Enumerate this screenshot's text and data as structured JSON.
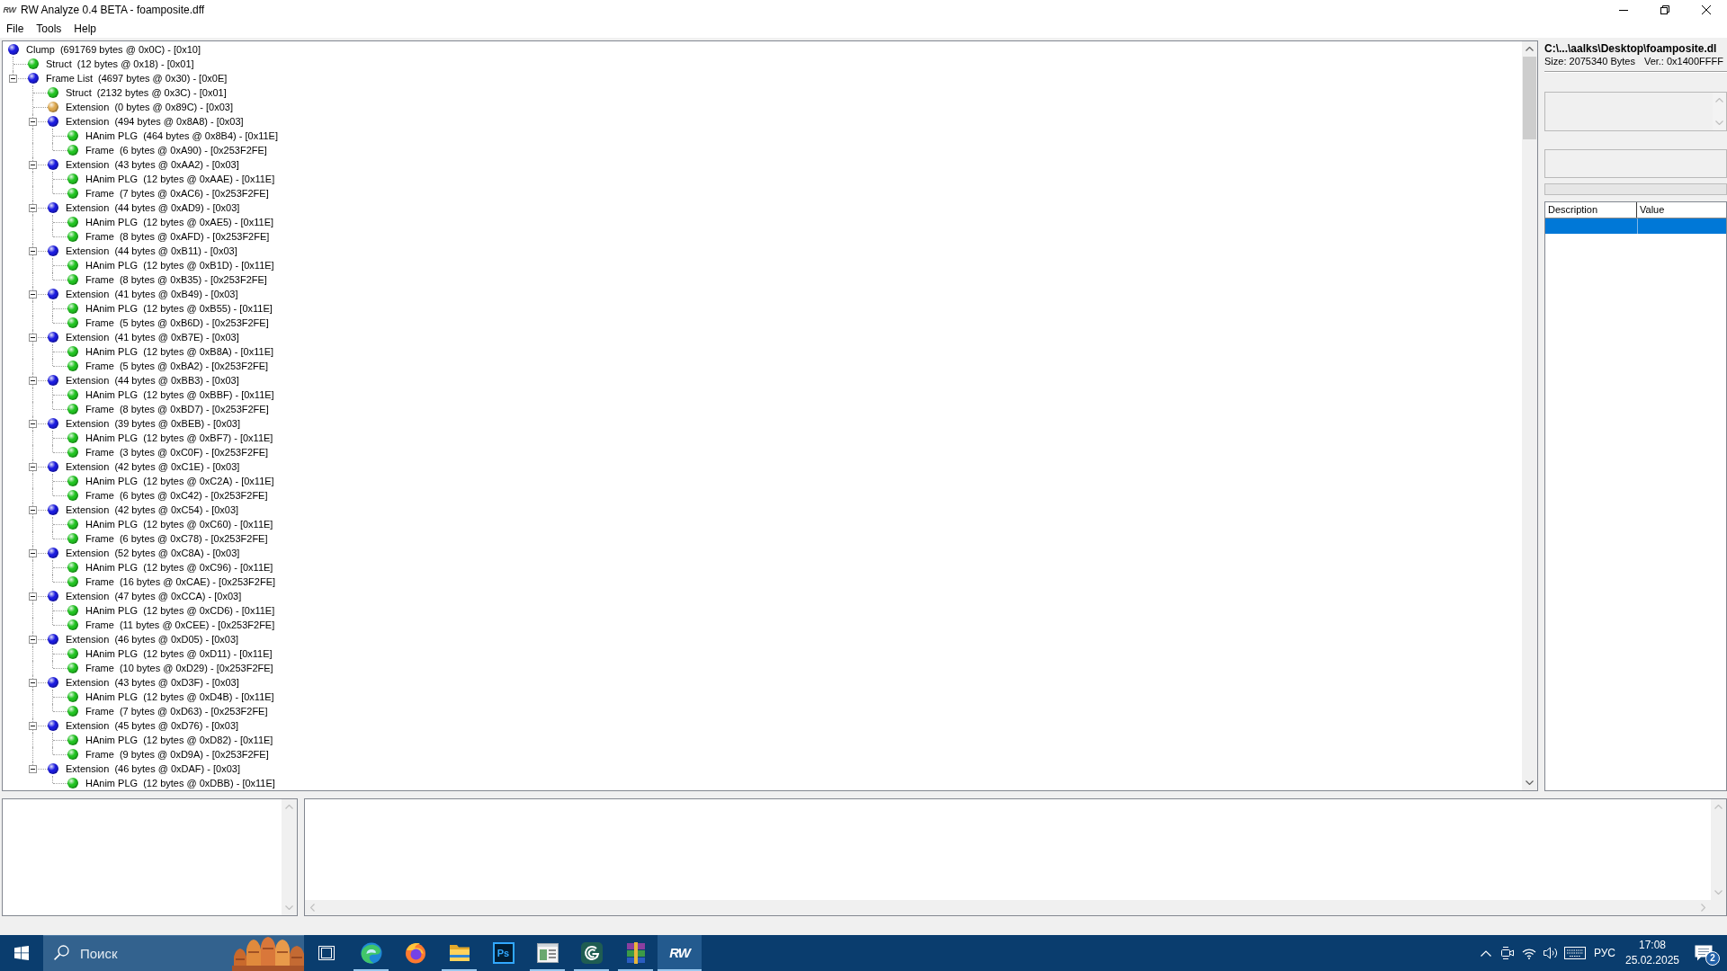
{
  "window": {
    "icon_text": "RW",
    "title": "RW Analyze 0.4 BETA - foamposite.dff"
  },
  "menu": [
    "File",
    "Tools",
    "Help"
  ],
  "tree": [
    {
      "label": "Clump  (691769 bytes @ 0x0C) - [0x10]",
      "color": "#1c1ce0",
      "children": [
        {
          "label": "Struct  (12 bytes @ 0x18) - [0x01]",
          "color": "#22c422"
        },
        {
          "label": "Frame List  (4697 bytes @ 0x30) - [0x0E]",
          "color": "#1c1ce0",
          "expanded": true,
          "children": [
            {
              "label": "Struct  (2132 bytes @ 0x3C) - [0x01]",
              "color": "#22c422"
            },
            {
              "label": "Extension  (0 bytes @ 0x89C) - [0x03]",
              "color": "#dea94f"
            },
            {
              "label": "Extension  (494 bytes @ 0x8A8) - [0x03]",
              "color": "#1c1ce0",
              "expanded": true,
              "children": [
                {
                  "label": "HAnim PLG  (464 bytes @ 0x8B4) - [0x11E]",
                  "color": "#22c422"
                },
                {
                  "label": "Frame  (6 bytes @ 0xA90) - [0x253F2FE]",
                  "color": "#22c422"
                }
              ]
            },
            {
              "label": "Extension  (43 bytes @ 0xAA2) - [0x03]",
              "color": "#1c1ce0",
              "expanded": true,
              "children": [
                {
                  "label": "HAnim PLG  (12 bytes @ 0xAAE) - [0x11E]",
                  "color": "#22c422"
                },
                {
                  "label": "Frame  (7 bytes @ 0xAC6) - [0x253F2FE]",
                  "color": "#22c422"
                }
              ]
            },
            {
              "label": "Extension  (44 bytes @ 0xAD9) - [0x03]",
              "color": "#1c1ce0",
              "expanded": true,
              "children": [
                {
                  "label": "HAnim PLG  (12 bytes @ 0xAE5) - [0x11E]",
                  "color": "#22c422"
                },
                {
                  "label": "Frame  (8 bytes @ 0xAFD) - [0x253F2FE]",
                  "color": "#22c422"
                }
              ]
            },
            {
              "label": "Extension  (44 bytes @ 0xB11) - [0x03]",
              "color": "#1c1ce0",
              "expanded": true,
              "children": [
                {
                  "label": "HAnim PLG  (12 bytes @ 0xB1D) - [0x11E]",
                  "color": "#22c422"
                },
                {
                  "label": "Frame  (8 bytes @ 0xB35) - [0x253F2FE]",
                  "color": "#22c422"
                }
              ]
            },
            {
              "label": "Extension  (41 bytes @ 0xB49) - [0x03]",
              "color": "#1c1ce0",
              "expanded": true,
              "children": [
                {
                  "label": "HAnim PLG  (12 bytes @ 0xB55) - [0x11E]",
                  "color": "#22c422"
                },
                {
                  "label": "Frame  (5 bytes @ 0xB6D) - [0x253F2FE]",
                  "color": "#22c422"
                }
              ]
            },
            {
              "label": "Extension  (41 bytes @ 0xB7E) - [0x03]",
              "color": "#1c1ce0",
              "expanded": true,
              "children": [
                {
                  "label": "HAnim PLG  (12 bytes @ 0xB8A) - [0x11E]",
                  "color": "#22c422"
                },
                {
                  "label": "Frame  (5 bytes @ 0xBA2) - [0x253F2FE]",
                  "color": "#22c422"
                }
              ]
            },
            {
              "label": "Extension  (44 bytes @ 0xBB3) - [0x03]",
              "color": "#1c1ce0",
              "expanded": true,
              "children": [
                {
                  "label": "HAnim PLG  (12 bytes @ 0xBBF) - [0x11E]",
                  "color": "#22c422"
                },
                {
                  "label": "Frame  (8 bytes @ 0xBD7) - [0x253F2FE]",
                  "color": "#22c422"
                }
              ]
            },
            {
              "label": "Extension  (39 bytes @ 0xBEB) - [0x03]",
              "color": "#1c1ce0",
              "expanded": true,
              "children": [
                {
                  "label": "HAnim PLG  (12 bytes @ 0xBF7) - [0x11E]",
                  "color": "#22c422"
                },
                {
                  "label": "Frame  (3 bytes @ 0xC0F) - [0x253F2FE]",
                  "color": "#22c422"
                }
              ]
            },
            {
              "label": "Extension  (42 bytes @ 0xC1E) - [0x03]",
              "color": "#1c1ce0",
              "expanded": true,
              "children": [
                {
                  "label": "HAnim PLG  (12 bytes @ 0xC2A) - [0x11E]",
                  "color": "#22c422"
                },
                {
                  "label": "Frame  (6 bytes @ 0xC42) - [0x253F2FE]",
                  "color": "#22c422"
                }
              ]
            },
            {
              "label": "Extension  (42 bytes @ 0xC54) - [0x03]",
              "color": "#1c1ce0",
              "expanded": true,
              "children": [
                {
                  "label": "HAnim PLG  (12 bytes @ 0xC60) - [0x11E]",
                  "color": "#22c422"
                },
                {
                  "label": "Frame  (6 bytes @ 0xC78) - [0x253F2FE]",
                  "color": "#22c422"
                }
              ]
            },
            {
              "label": "Extension  (52 bytes @ 0xC8A) - [0x03]",
              "color": "#1c1ce0",
              "expanded": true,
              "children": [
                {
                  "label": "HAnim PLG  (12 bytes @ 0xC96) - [0x11E]",
                  "color": "#22c422"
                },
                {
                  "label": "Frame  (16 bytes @ 0xCAE) - [0x253F2FE]",
                  "color": "#22c422"
                }
              ]
            },
            {
              "label": "Extension  (47 bytes @ 0xCCA) - [0x03]",
              "color": "#1c1ce0",
              "expanded": true,
              "children": [
                {
                  "label": "HAnim PLG  (12 bytes @ 0xCD6) - [0x11E]",
                  "color": "#22c422"
                },
                {
                  "label": "Frame  (11 bytes @ 0xCEE) - [0x253F2FE]",
                  "color": "#22c422"
                }
              ]
            },
            {
              "label": "Extension  (46 bytes @ 0xD05) - [0x03]",
              "color": "#1c1ce0",
              "expanded": true,
              "children": [
                {
                  "label": "HAnim PLG  (12 bytes @ 0xD11) - [0x11E]",
                  "color": "#22c422"
                },
                {
                  "label": "Frame  (10 bytes @ 0xD29) - [0x253F2FE]",
                  "color": "#22c422"
                }
              ]
            },
            {
              "label": "Extension  (43 bytes @ 0xD3F) - [0x03]",
              "color": "#1c1ce0",
              "expanded": true,
              "children": [
                {
                  "label": "HAnim PLG  (12 bytes @ 0xD4B) - [0x11E]",
                  "color": "#22c422"
                },
                {
                  "label": "Frame  (7 bytes @ 0xD63) - [0x253F2FE]",
                  "color": "#22c422"
                }
              ]
            },
            {
              "label": "Extension  (45 bytes @ 0xD76) - [0x03]",
              "color": "#1c1ce0",
              "expanded": true,
              "children": [
                {
                  "label": "HAnim PLG  (12 bytes @ 0xD82) - [0x11E]",
                  "color": "#22c422"
                },
                {
                  "label": "Frame  (9 bytes @ 0xD9A) - [0x253F2FE]",
                  "color": "#22c422"
                }
              ]
            },
            {
              "label": "Extension  (46 bytes @ 0xDAF) - [0x03]",
              "color": "#1c1ce0",
              "expanded": true,
              "children": [
                {
                  "label": "HAnim PLG  (12 bytes @ 0xDBB) - [0x11E]",
                  "color": "#22c422"
                }
              ]
            }
          ]
        }
      ]
    }
  ],
  "file_info": {
    "path": "C:\\...\\aalks\\Desktop\\foamposite.dl",
    "size": "Size: 2075340 Bytes",
    "version": "Ver.: 0x1400FFFF"
  },
  "properties": {
    "columns": [
      "Description",
      "Value"
    ],
    "rows": [
      {
        "selected": true
      }
    ]
  },
  "taskbar": {
    "search": {
      "placeholder": "Поиск"
    },
    "apps": [
      {
        "kind": "swirl",
        "running": true,
        "selected": false
      },
      {
        "kind": "flame",
        "running": false,
        "selected": false
      },
      {
        "kind": "folder",
        "running": true,
        "selected": false
      },
      {
        "kind": "ps",
        "label": "Ps",
        "running": false,
        "selected": false
      },
      {
        "kind": "window",
        "running": true,
        "selected": false
      },
      {
        "kind": "spiral",
        "running": true,
        "selected": false
      },
      {
        "kind": "books",
        "running": true,
        "selected": false
      },
      {
        "kind": "rw",
        "label": "RW",
        "running": true,
        "selected": true
      }
    ],
    "tray": {
      "language": "РУС",
      "time": "17:08",
      "date": "25.02.2025",
      "notifications": "2"
    }
  }
}
